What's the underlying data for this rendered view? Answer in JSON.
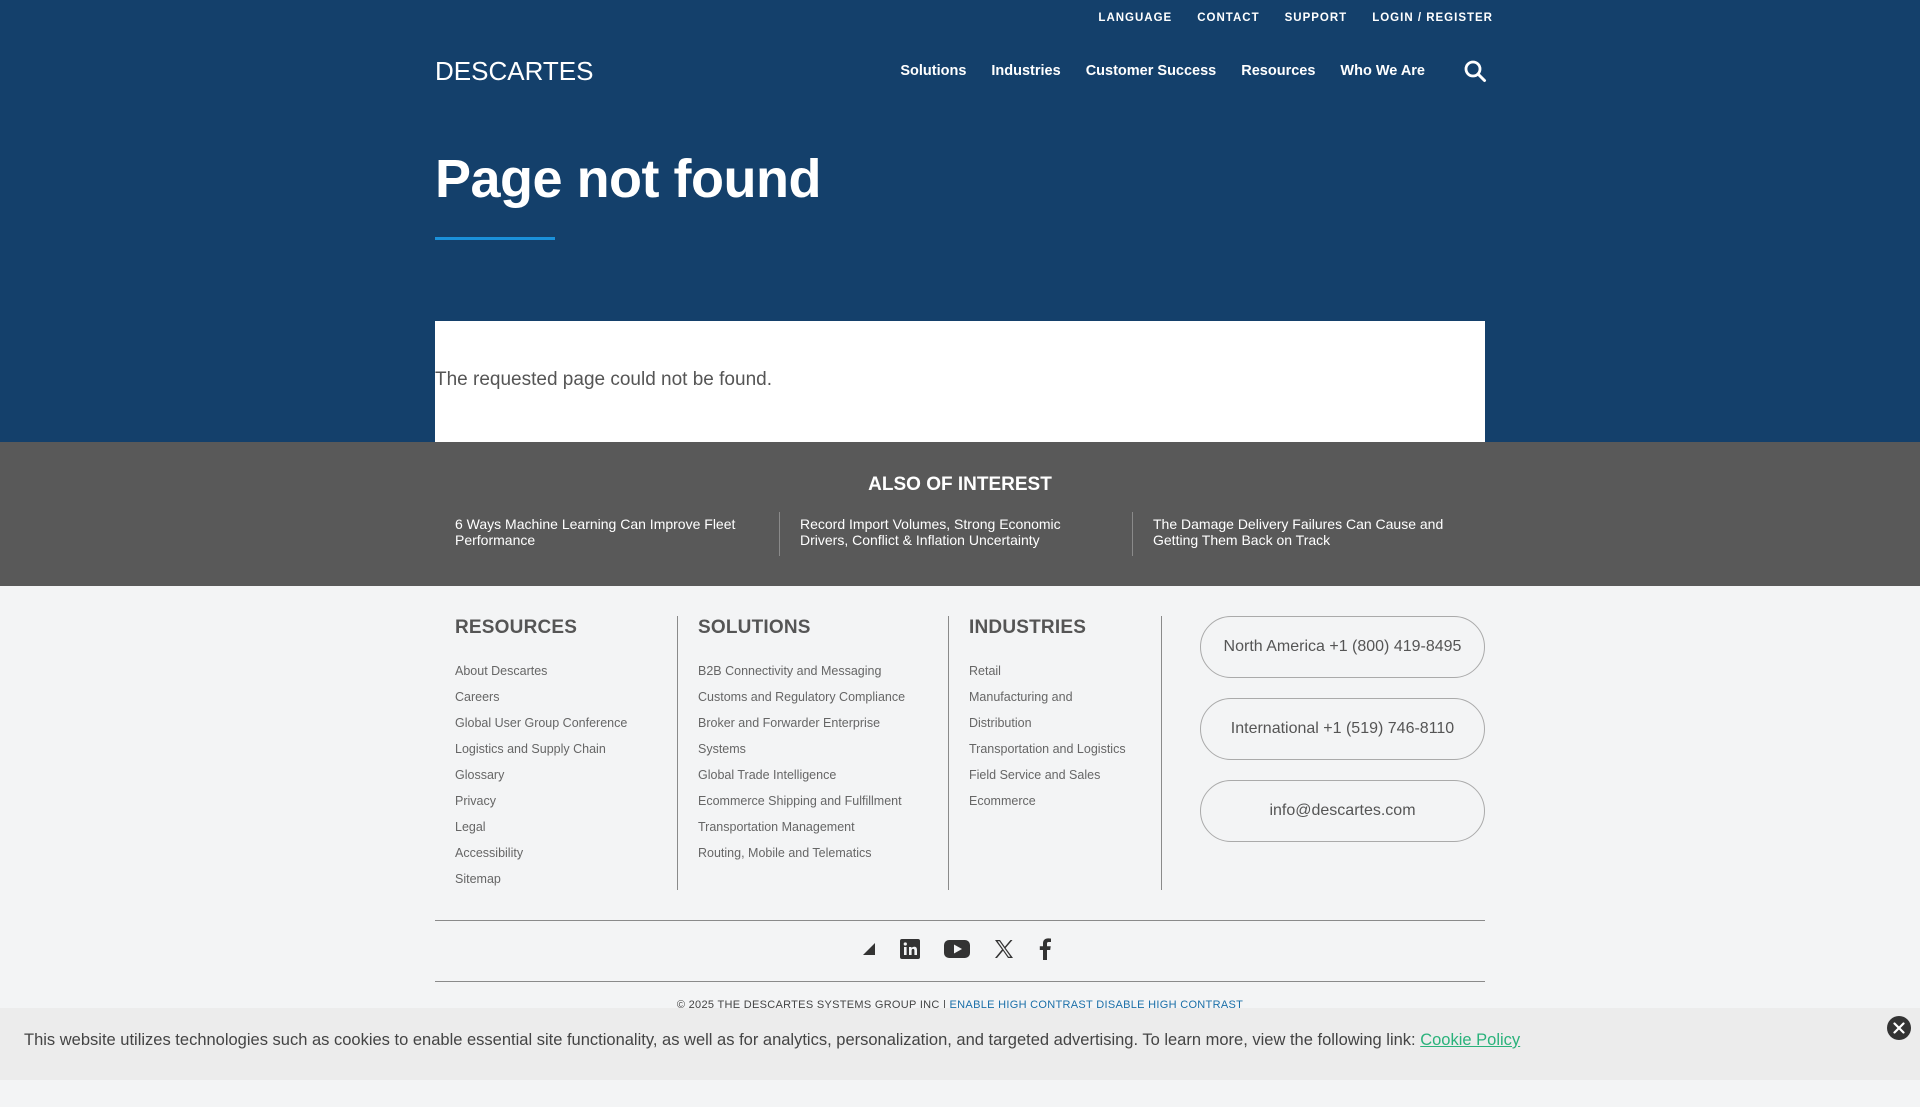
{
  "utility_nav": [
    "LANGUAGE",
    "CONTACT",
    "SUPPORT",
    "LOGIN / REGISTER"
  ],
  "logo": {
    "text": "DESCARTES",
    "trademark": "™"
  },
  "main_nav": [
    "Solutions",
    "Industries",
    "Customer Success",
    "Resources",
    "Who We Are"
  ],
  "hero": {
    "title": "Page not found"
  },
  "notice": "The requested page could not be found.",
  "interest": {
    "title": "ALSO OF INTEREST",
    "items": [
      "6 Ways Machine Learning Can Improve Fleet Performance",
      "Record Import Volumes, Strong Economic Drivers, Conflict & Inflation Uncertainty",
      "The Damage Delivery Failures Can Cause and Getting Them Back on Track"
    ]
  },
  "footer": {
    "resources": {
      "title": "RESOURCES",
      "items": [
        "About Descartes",
        "Careers",
        "Global User Group Conference",
        "Logistics and Supply Chain",
        "Glossary",
        "Privacy",
        "Legal",
        "Accessibility",
        "Sitemap"
      ]
    },
    "solutions": {
      "title": "SOLUTIONS",
      "items": [
        "B2B Connectivity and Messaging",
        "Customs and Regulatory Compliance",
        "Broker and Forwarder Enterprise",
        "Systems",
        "Global Trade Intelligence",
        "Ecommerce Shipping and Fulfillment",
        "Transportation Management",
        "Routing, Mobile and Telematics"
      ]
    },
    "industries": {
      "title": "INDUSTRIES",
      "items": [
        "Retail",
        "Manufacturing and",
        "Distribution",
        "Transportation and Logistics",
        "Field Service and Sales",
        "Ecommerce"
      ]
    },
    "contacts": {
      "north_america": "North America  +1 (800) 419-8495",
      "international": "International +1 (519) 746-8110",
      "email": "info@descartes.com"
    },
    "social_icons": [
      "descartes-icon",
      "linkedin-icon",
      "youtube-icon",
      "x-icon",
      "facebook-icon"
    ],
    "copyright": "© 2025 THE DESCARTES SYSTEMS GROUP INC |",
    "enable_high_contrast": "ENABLE HIGH CONTRAST",
    "disable_high_contrast": "DISABLE HIGH CONTRAST"
  },
  "cookie": {
    "text": "This website utilizes technologies such as cookies to enable essential site functionality, as well as for analytics, personalization, and targeted advertising. To learn more, view the following link:",
    "link": "Cookie Policy"
  },
  "colors": {
    "navy": "#14406b",
    "accent_blue": "#1b91da",
    "gray_band": "#595959",
    "footer_bg": "#f3f4f5",
    "cookie_link": "#2ab27b"
  }
}
